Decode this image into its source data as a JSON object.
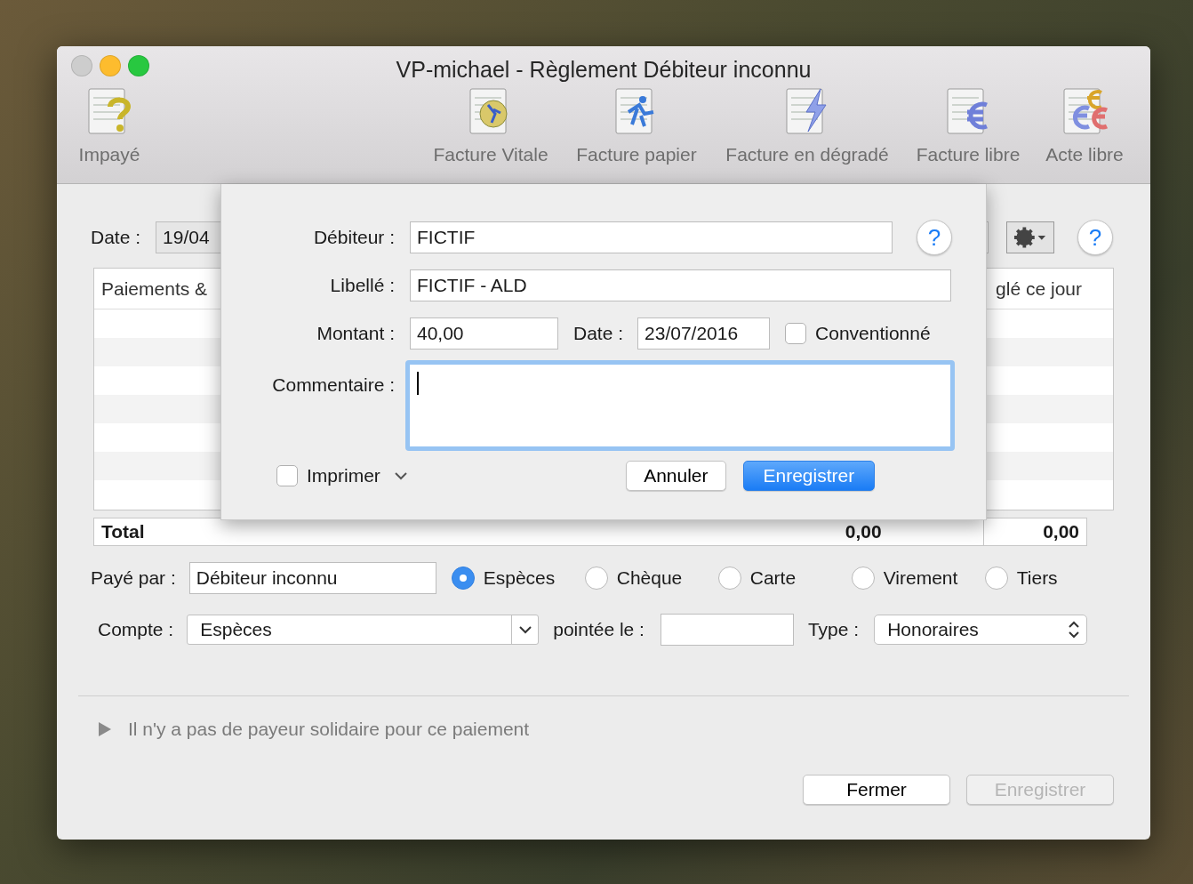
{
  "window": {
    "title": "VP-michael - Règlement Débiteur inconnu"
  },
  "toolbar": [
    {
      "label": "Impayé"
    },
    {
      "label": "Facture Vitale"
    },
    {
      "label": "Facture papier"
    },
    {
      "label": "Facture en dégradé"
    },
    {
      "label": "Facture libre"
    },
    {
      "label": "Acte libre"
    }
  ],
  "main": {
    "date": {
      "label": "Date :",
      "value": "19/04"
    },
    "help_label": "?",
    "table": {
      "columns": [
        "Paiements &",
        "glé ce jour"
      ],
      "total_label": "Total",
      "total_values": [
        "0,00",
        "0,00"
      ]
    },
    "paid_by": {
      "label": "Payé par :",
      "value": "Débiteur inconnu"
    },
    "payment_methods": [
      {
        "label": "Espèces",
        "selected": true
      },
      {
        "label": "Chèque",
        "selected": false
      },
      {
        "label": "Carte",
        "selected": false
      },
      {
        "label": "Virement",
        "selected": false
      },
      {
        "label": "Tiers",
        "selected": false
      }
    ],
    "account": {
      "label": "Compte :",
      "value": "Espèces"
    },
    "pointed": {
      "label": "pointée le :"
    },
    "type": {
      "label": "Type :",
      "value": "Honoraires"
    },
    "disclosure": {
      "text": "Il n'y a pas de payeur solidaire pour ce paiement",
      "expanded": false
    },
    "buttons": [
      {
        "label": "Fermer",
        "disabled": false
      },
      {
        "label": "Enregistrer",
        "disabled": true
      }
    ]
  },
  "sheet": {
    "help_label": "?",
    "debiteur": {
      "label": "Débiteur :",
      "value": "FICTIF"
    },
    "libelle": {
      "label": "Libellé :",
      "value": "FICTIF - ALD"
    },
    "montant": {
      "label": "Montant :",
      "value": "40,00"
    },
    "date": {
      "label": "Date :",
      "value": "23/07/2016"
    },
    "conventionne": {
      "label": "Conventionné",
      "checked": false
    },
    "commentaire": {
      "label": "Commentaire :",
      "focused": true
    },
    "imprimer": {
      "label": "Imprimer",
      "checked": false
    },
    "buttons": [
      {
        "label": "Annuler",
        "default": false
      },
      {
        "label": "Enregistrer",
        "default": true
      }
    ]
  }
}
